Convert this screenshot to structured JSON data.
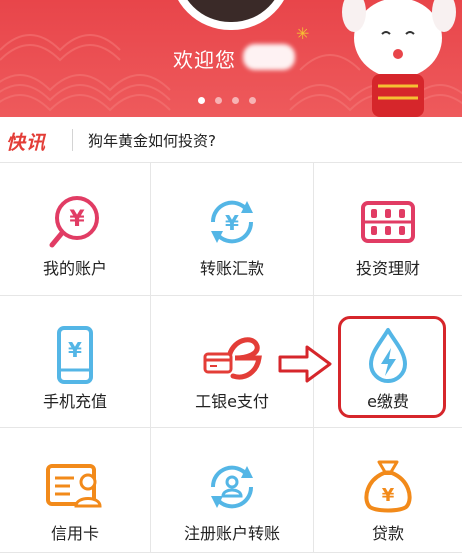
{
  "banner": {
    "welcome_text": "欢迎您",
    "slides": 4,
    "active_slide": 1
  },
  "news": {
    "tag": "快讯",
    "headline": "狗年黄金如何投资?"
  },
  "services": [
    {
      "label": "我的账户",
      "icon": "account-search-icon",
      "color": "#e13c64"
    },
    {
      "label": "转账汇款",
      "icon": "transfer-icon",
      "color": "#54b6e6"
    },
    {
      "label": "投资理财",
      "icon": "abacus-icon",
      "color": "#e13c64"
    },
    {
      "label": "手机充值",
      "icon": "phone-topup-icon",
      "color": "#54b6e6"
    },
    {
      "label": "工银e支付",
      "icon": "epay-icon",
      "color": "#e33d37"
    },
    {
      "label": "e缴费",
      "icon": "water-drop-bolt-icon",
      "color": "#54b6e6"
    },
    {
      "label": "信用卡",
      "icon": "credit-card-icon",
      "color": "#f28a1a"
    },
    {
      "label": "注册账户转账",
      "icon": "registered-transfer-icon",
      "color": "#54b6e6"
    },
    {
      "label": "贷款",
      "icon": "money-bag-icon",
      "color": "#f28a1a"
    }
  ],
  "colors": {
    "banner": "#e8454a",
    "accent_red": "#e13c64",
    "accent_blue": "#54b6e6",
    "accent_orange": "#f28a1a",
    "annotation": "#d6262b"
  }
}
